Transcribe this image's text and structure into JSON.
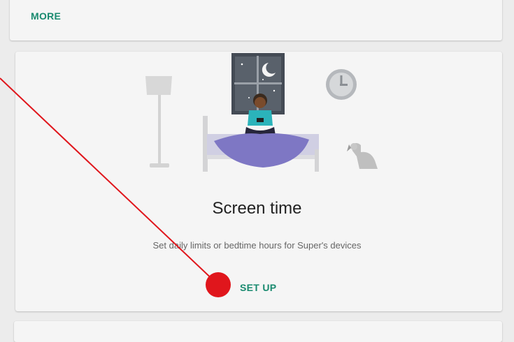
{
  "top_card": {
    "more_label": "MORE"
  },
  "screen_time_card": {
    "title": "Screen time",
    "description": "Set daily limits or bedtime hours for Super's devices",
    "setup_label": "SET UP"
  },
  "colors": {
    "accent": "#198a6f",
    "annotation": "#e0161c",
    "card_background": "#f5f5f5",
    "page_background": "#ececec"
  },
  "icons": [
    "floor-lamp-icon",
    "night-window-icon",
    "wall-clock-icon",
    "bed-icon",
    "person-with-phone-icon",
    "dog-icon",
    "click-marker-icon"
  ]
}
